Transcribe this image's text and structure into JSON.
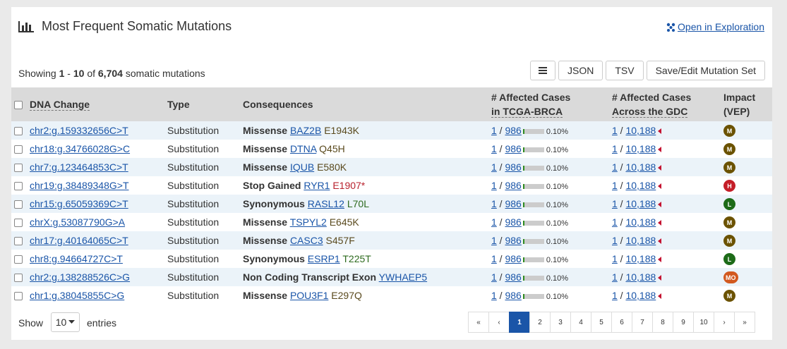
{
  "header": {
    "title": "Most Frequent Somatic Mutations",
    "explore_link": "Open in Exploration"
  },
  "summary": {
    "prefix": "Showing",
    "start": "1",
    "dash": "-",
    "end": "10",
    "of": "of",
    "total": "6,704",
    "suffix": "somatic mutations"
  },
  "toolbar": {
    "json_label": "JSON",
    "tsv_label": "TSV",
    "save_label": "Save/Edit Mutation Set"
  },
  "columns": {
    "dna_change": "DNA Change",
    "type": "Type",
    "consequences": "Consequences",
    "affected_line1": "# Affected Cases",
    "affected_line2": "in TCGA-BRCA",
    "across_line1": "# Affected Cases",
    "across_line2": "Across the GDC",
    "impact_line1": "Impact",
    "impact_line2": "(VEP)"
  },
  "rows": [
    {
      "dna": "chr2:g.159332656C>T",
      "type": "Substitution",
      "cons": "Missense",
      "gene": "BAZ2B",
      "aa": "E1943K",
      "aa_color": "#5a4a1e",
      "cases": "1",
      "cases_total": "986",
      "pct": "0.10%",
      "pct_value": 0.1,
      "gdc": "1",
      "gdc_total": "10,188",
      "impact": "M",
      "impact_color": "#6b5200"
    },
    {
      "dna": "chr18:g.34766028G>C",
      "type": "Substitution",
      "cons": "Missense",
      "gene": "DTNA",
      "aa": "Q45H",
      "aa_color": "#5a4a1e",
      "cases": "1",
      "cases_total": "986",
      "pct": "0.10%",
      "pct_value": 0.1,
      "gdc": "1",
      "gdc_total": "10,188",
      "impact": "M",
      "impact_color": "#6b5200"
    },
    {
      "dna": "chr7:g.123464853C>T",
      "type": "Substitution",
      "cons": "Missense",
      "gene": "IQUB",
      "aa": "E580K",
      "aa_color": "#5a4a1e",
      "cases": "1",
      "cases_total": "986",
      "pct": "0.10%",
      "pct_value": 0.1,
      "gdc": "1",
      "gdc_total": "10,188",
      "impact": "M",
      "impact_color": "#6b5200"
    },
    {
      "dna": "chr19:g.38489348G>T",
      "type": "Substitution",
      "cons": "Stop Gained",
      "gene": "RYR1",
      "aa": "E1907*",
      "aa_color": "#b8222e",
      "cases": "1",
      "cases_total": "986",
      "pct": "0.10%",
      "pct_value": 0.1,
      "gdc": "1",
      "gdc_total": "10,188",
      "impact": "H",
      "impact_color": "#c41e28"
    },
    {
      "dna": "chr15:g.65059369C>T",
      "type": "Substitution",
      "cons": "Synonymous",
      "gene": "RASL12",
      "aa": "L70L",
      "aa_color": "#2e6b1f",
      "cases": "1",
      "cases_total": "986",
      "pct": "0.10%",
      "pct_value": 0.1,
      "gdc": "1",
      "gdc_total": "10,188",
      "impact": "L",
      "impact_color": "#1d6b18"
    },
    {
      "dna": "chrX:g.53087790G>A",
      "type": "Substitution",
      "cons": "Missense",
      "gene": "TSPYL2",
      "aa": "E645K",
      "aa_color": "#5a4a1e",
      "cases": "1",
      "cases_total": "986",
      "pct": "0.10%",
      "pct_value": 0.1,
      "gdc": "1",
      "gdc_total": "10,188",
      "impact": "M",
      "impact_color": "#6b5200"
    },
    {
      "dna": "chr17:g.40164065C>T",
      "type": "Substitution",
      "cons": "Missense",
      "gene": "CASC3",
      "aa": "S457F",
      "aa_color": "#5a4a1e",
      "cases": "1",
      "cases_total": "986",
      "pct": "0.10%",
      "pct_value": 0.1,
      "gdc": "1",
      "gdc_total": "10,188",
      "impact": "M",
      "impact_color": "#6b5200"
    },
    {
      "dna": "chr8:g.94664727C>T",
      "type": "Substitution",
      "cons": "Synonymous",
      "gene": "ESRP1",
      "aa": "T225T",
      "aa_color": "#2e6b1f",
      "cases": "1",
      "cases_total": "986",
      "pct": "0.10%",
      "pct_value": 0.1,
      "gdc": "1",
      "gdc_total": "10,188",
      "impact": "L",
      "impact_color": "#1d6b18"
    },
    {
      "dna": "chr2:g.138288526C>G",
      "type": "Substitution",
      "cons": "Non Coding Transcript Exon",
      "gene": "YWHAEP5",
      "aa": "",
      "aa_color": "#5a4a1e",
      "cases": "1",
      "cases_total": "986",
      "pct": "0.10%",
      "pct_value": 0.1,
      "gdc": "1",
      "gdc_total": "10,188",
      "impact": "MO",
      "impact_color": "#d2591f"
    },
    {
      "dna": "chr1:g.38045855C>G",
      "type": "Substitution",
      "cons": "Missense",
      "gene": "POU3F1",
      "aa": "E297Q",
      "aa_color": "#5a4a1e",
      "cases": "1",
      "cases_total": "986",
      "pct": "0.10%",
      "pct_value": 0.1,
      "gdc": "1",
      "gdc_total": "10,188",
      "impact": "M",
      "impact_color": "#6b5200"
    }
  ],
  "footer": {
    "show_label": "Show",
    "entries_value": "10",
    "entries_label": "entries"
  },
  "pagination": {
    "first": "«",
    "prev": "‹",
    "next": "›",
    "last": "»",
    "pages": [
      "1",
      "2",
      "3",
      "4",
      "5",
      "6",
      "7",
      "8",
      "9",
      "10"
    ],
    "current": "1"
  },
  "colors": {
    "link": "#1a55a8",
    "header_bg": "#dadada",
    "row_stripe": "#ebf3f9",
    "active_page": "#1a55a8"
  }
}
